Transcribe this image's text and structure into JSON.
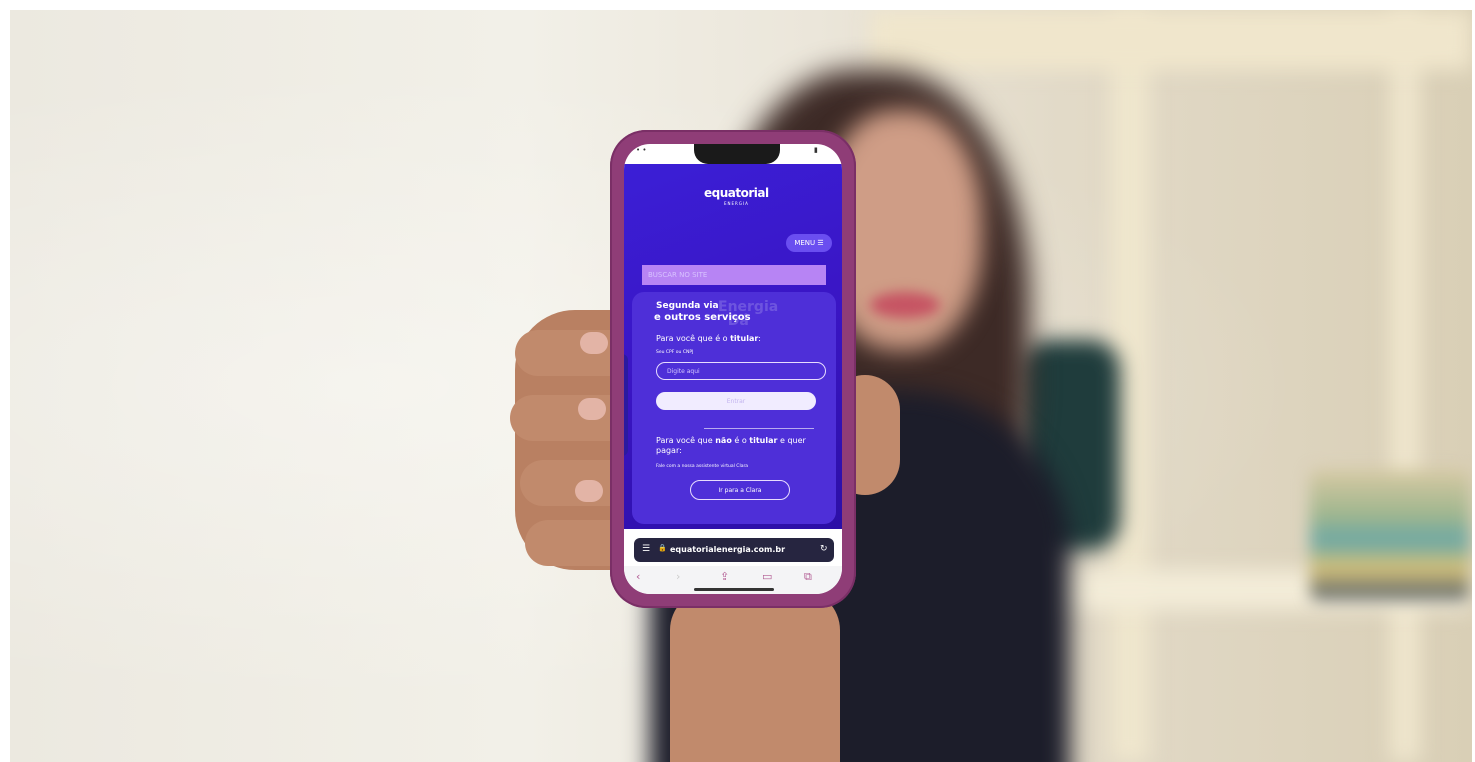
{
  "site": {
    "logo": "equatorial",
    "logo_sub": "ENERGIA",
    "menu_label": "MENU ☰",
    "search_placeholder": "BUSCAR NO SITE",
    "watermark": "Energia\n  Dá",
    "card_title_line1": "Segunda via",
    "card_title_line2": "e outros serviços",
    "titular_prefix": "Para você que é o ",
    "titular_bold": "titular",
    "titular_suffix": ":",
    "cpf_label": "Seu CPF ou CNPJ",
    "cpf_placeholder": "Digite aqui",
    "enter_label": "Entrar",
    "nao_prefix": "Para você que ",
    "nao_bold1": "não",
    "nao_mid": " é o ",
    "nao_bold2": "titular",
    "nao_suffix": " e quer pagar:",
    "assistant_text": "Fale com a nossa assistente virtual Clara",
    "clara_button": "Ir para a Clara"
  },
  "browser": {
    "url": "equatorialenergia.com.br",
    "lock": "🔒",
    "reload": "↻"
  },
  "colors": {
    "site_bg": "#3a15c4",
    "phone_case": "#8f3d77",
    "card": "#4e2fd8"
  }
}
